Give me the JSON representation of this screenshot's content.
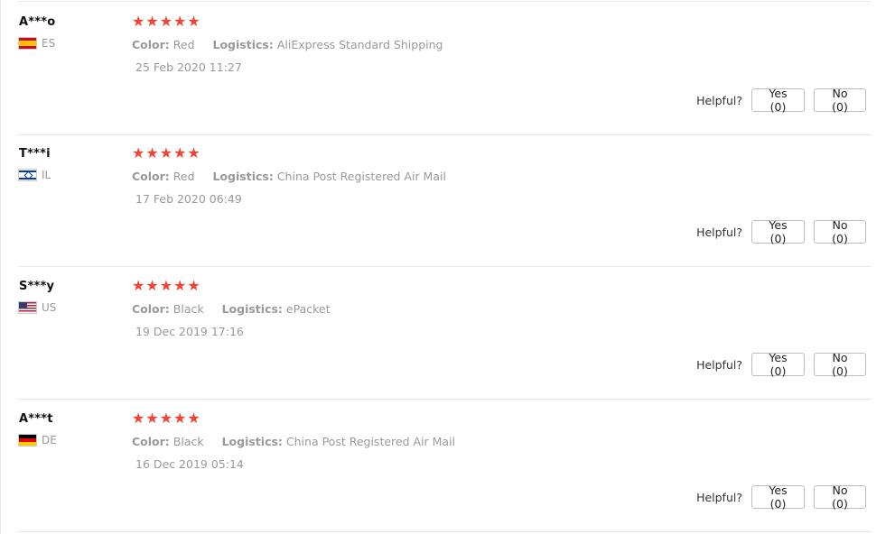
{
  "reviews": [
    {
      "user": "A***o",
      "country_code": "ES",
      "flag": "flag-es",
      "stars": "★★★★★",
      "color_label": "Color:",
      "color_value": "Red",
      "logistics_label": "Logistics:",
      "logistics_value": "AliExpress Standard Shipping",
      "date": "25 Feb 2020 11:27",
      "helpful_label": "Helpful?",
      "yes_label": "Yes (0)",
      "no_label": "No (0)"
    },
    {
      "user": "T***i",
      "country_code": "IL",
      "flag": "flag-il",
      "stars": "★★★★★",
      "color_label": "Color:",
      "color_value": "Red",
      "logistics_label": "Logistics:",
      "logistics_value": "China Post Registered Air Mail",
      "date": "17 Feb 2020 06:49",
      "helpful_label": "Helpful?",
      "yes_label": "Yes (0)",
      "no_label": "No (0)"
    },
    {
      "user": "S***y",
      "country_code": "US",
      "flag": "flag-us",
      "stars": "★★★★★",
      "color_label": "Color:",
      "color_value": "Black",
      "logistics_label": "Logistics:",
      "logistics_value": "ePacket",
      "date": "19 Dec 2019 17:16",
      "helpful_label": "Helpful?",
      "yes_label": "Yes (0)",
      "no_label": "No (0)"
    },
    {
      "user": "A***t",
      "country_code": "DE",
      "flag": "flag-de",
      "stars": "★★★★★",
      "color_label": "Color:",
      "color_value": "Black",
      "logistics_label": "Logistics:",
      "logistics_value": "China Post Registered Air Mail",
      "date": "16 Dec 2019 05:14",
      "helpful_label": "Helpful?",
      "yes_label": "Yes (0)",
      "no_label": "No (0)"
    }
  ],
  "colors": {
    "star": "#f44336",
    "muted_text": "#999999",
    "divider": "#e8e8e8"
  }
}
